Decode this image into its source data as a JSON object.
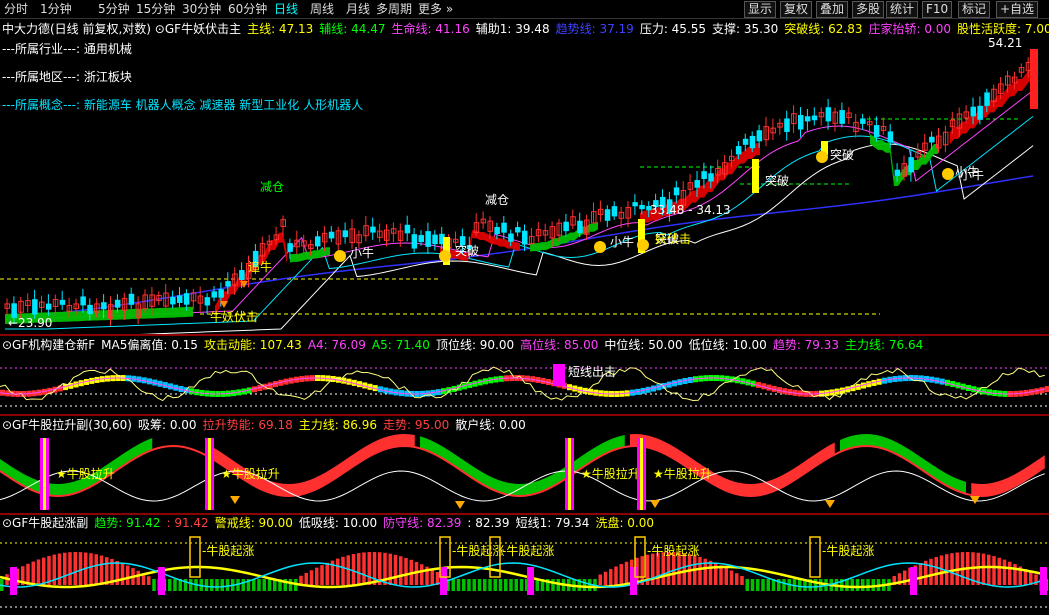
{
  "toolbar": {
    "timeframes": [
      "分时",
      "1分钟",
      "5分钟",
      "15分钟",
      "30分钟",
      "60分钟",
      "日线",
      "周线",
      "月线",
      "多周期",
      "更多"
    ],
    "active": "日线",
    "right_buttons": [
      "显示",
      "复权",
      "叠加",
      "多股",
      "统计",
      "F10",
      "标记",
      "+自选"
    ]
  },
  "main_panel": {
    "title": "中大力德(日线 前复权,对数)",
    "indicator": "GF牛妖伏击主",
    "values": [
      {
        "label": "主线:",
        "value": "47.13",
        "color": "#ffff00"
      },
      {
        "label": "辅线:",
        "value": "44.47",
        "color": "#00ff00"
      },
      {
        "label": "生命线:",
        "value": "41.16",
        "color": "#ff44ff"
      },
      {
        "label": "辅助1:",
        "value": "39.48",
        "color": "#ffffff"
      },
      {
        "label": "趋势线:",
        "value": "37.19",
        "color": "#4040ff"
      },
      {
        "label": "压力:",
        "value": "45.55",
        "color": "#ffffff"
      },
      {
        "label": "支撑:",
        "value": "35.30",
        "color": "#ffffff"
      },
      {
        "label": "突破线:",
        "value": "62.83",
        "color": "#ffff00"
      },
      {
        "label": "庄家抬轿:",
        "value": "0.00",
        "color": "#ff44ff"
      },
      {
        "label": "股性活跃度:",
        "value": "7.00",
        "color": "#ffff00"
      },
      {
        "label": "MA",
        "value": "",
        "color": "#ffffff"
      }
    ],
    "industry": "---所属行业---: 通用机械",
    "region": "---所属地区---: 浙江板块",
    "concepts": "---所属概念---: 新能源车 机器人概念 减速器 新型工业化 人形机器人",
    "high_label": "54.21",
    "low_label": "23.90",
    "annotations": [
      "减仓",
      "追牛",
      "牛妖伏击",
      "小牛",
      "突破",
      "减仓",
      "小牛",
      "突破",
      "妖伏击",
      "小牛",
      "突破",
      "小牛",
      "突破"
    ],
    "price_label": "33.48 - 34.13"
  },
  "panel2": {
    "indicator": "GF机构建仓新F",
    "values": [
      {
        "label": "MA5偏离值:",
        "value": "0.15",
        "color": "#ffffff"
      },
      {
        "label": "攻击动能:",
        "value": "107.43",
        "color": "#ffff00"
      },
      {
        "label": "A4:",
        "value": "76.09",
        "color": "#ff44ff"
      },
      {
        "label": "A5:",
        "value": "71.40",
        "color": "#00ff00"
      },
      {
        "label": "顶位线:",
        "value": "90.00",
        "color": "#ffffff"
      },
      {
        "label": "高位线:",
        "value": "85.00",
        "color": "#ff44ff"
      },
      {
        "label": "中位线:",
        "value": "50.00",
        "color": "#ffffff"
      },
      {
        "label": "低位线:",
        "value": "10.00",
        "color": "#ffffff"
      },
      {
        "label": "趋势:",
        "value": "79.33",
        "color": "#ff44ff"
      },
      {
        "label": "主力线:",
        "value": "76.64",
        "color": "#00ff00"
      }
    ],
    "annotation": "短线出击"
  },
  "panel3": {
    "indicator": "GF牛股拉升副(30,60)",
    "values": [
      {
        "label": "吸筹:",
        "value": "0.00",
        "color": "#ffffff"
      },
      {
        "label": "拉升势能:",
        "value": "69.18",
        "color": "#ff4040"
      },
      {
        "label": "主力线:",
        "value": "86.96",
        "color": "#ffff00"
      },
      {
        "label": "走势:",
        "value": "95.00",
        "color": "#ff4040"
      },
      {
        "label": "散户线:",
        "value": "0.00",
        "color": "#ffffff"
      }
    ],
    "annotation": "★牛股拉升"
  },
  "panel4": {
    "indicator": "GF牛股起涨副",
    "values": [
      {
        "label": "趋势:",
        "value": "91.42",
        "color": "#00ff00"
      },
      {
        "label": ":",
        "value": "91.42",
        "color": "#ff4040"
      },
      {
        "label": "警戒线:",
        "value": "90.00",
        "color": "#ffff00"
      },
      {
        "label": "低吸线:",
        "value": "10.00",
        "color": "#ffffff"
      },
      {
        "label": "防守线:",
        "value": "82.39",
        "color": "#ff44ff"
      },
      {
        "label": ":",
        "value": "82.39",
        "color": "#ffffff"
      },
      {
        "label": "短线1:",
        "value": "79.34",
        "color": "#ffffff"
      },
      {
        "label": "洗盘:",
        "value": "0.00",
        "color": "#ffff00"
      }
    ],
    "annotation": "牛股起涨"
  }
}
